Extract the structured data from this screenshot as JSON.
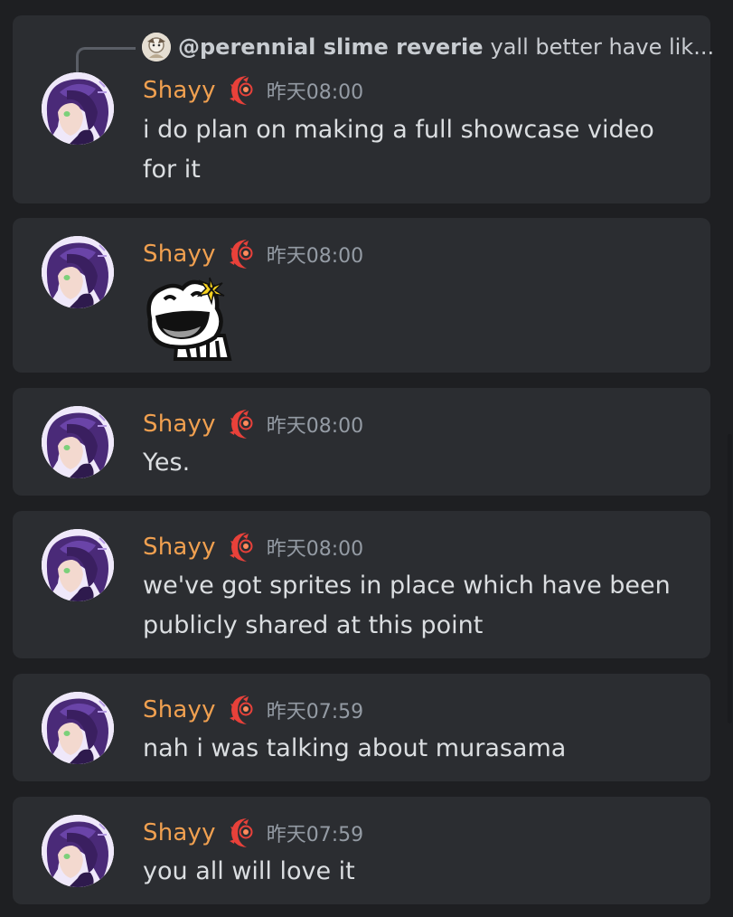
{
  "reply": {
    "name": "@perennial slime reverie",
    "text": "yall better have lik..."
  },
  "messages": [
    {
      "username": "Shayy",
      "timestamp": "昨天08:00",
      "content": "i do plan on making a full showcase video for it"
    },
    {
      "username": "Shayy",
      "timestamp": "昨天08:00",
      "content": "",
      "sticker": "laughing-frog-sticker"
    },
    {
      "username": "Shayy",
      "timestamp": "昨天08:00",
      "content": "Yes."
    },
    {
      "username": "Shayy",
      "timestamp": "昨天08:00",
      "content": "we've got sprites in place which have been publicly shared at this point"
    },
    {
      "username": "Shayy",
      "timestamp": "昨天07:59",
      "content": "nah i was talking about murasama"
    },
    {
      "username": "Shayy",
      "timestamp": "昨天07:59",
      "content": "you all will love it"
    }
  ],
  "colors": {
    "background": "#1e1f22",
    "card": "#2b2d31",
    "username": "#f0a050",
    "timestamp": "#949ba4",
    "text": "#dbdee1",
    "role_icon": "#e8413a"
  },
  "icons": {
    "avatar": "purple-haired-character-avatar",
    "role": "red-crescent-role-icon"
  }
}
